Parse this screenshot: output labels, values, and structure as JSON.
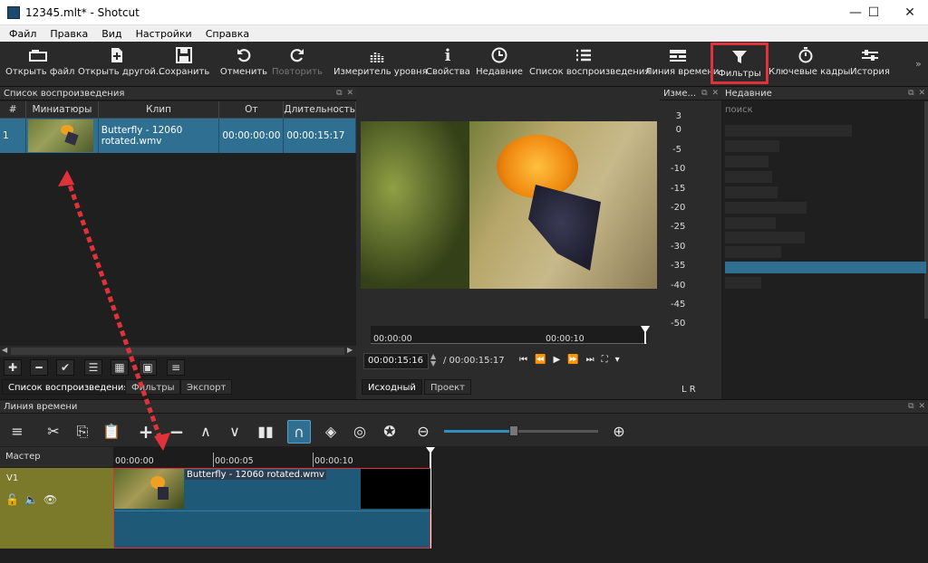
{
  "window": {
    "title": "12345.mlt* - Shotcut",
    "min": "—",
    "max": "☐",
    "close": "✕"
  },
  "menu": [
    "Файл",
    "Правка",
    "Вид",
    "Настройки",
    "Справка"
  ],
  "toolbar": [
    {
      "label": "Открыть файл",
      "icon": "open-file-icon"
    },
    {
      "label": "Открыть другой...",
      "icon": "open-other-icon"
    },
    {
      "label": "Сохранить",
      "icon": "save-icon"
    },
    {
      "label": "Отменить",
      "icon": "undo-icon"
    },
    {
      "label": "Повторить",
      "icon": "redo-icon"
    },
    {
      "label": "Измеритель уровня",
      "icon": "audio-meter-icon"
    },
    {
      "label": "Свойства",
      "icon": "info-icon"
    },
    {
      "label": "Недавние",
      "icon": "clock-icon"
    },
    {
      "label": "Список воспроизведения",
      "icon": "list-icon"
    },
    {
      "label": "Линия времени",
      "icon": "timeline-icon"
    },
    {
      "label": "Фильтры",
      "icon": "filter-icon"
    },
    {
      "label": "Ключевые кадры",
      "icon": "stopwatch-icon"
    },
    {
      "label": "История",
      "icon": "history-icon"
    }
  ],
  "playlist": {
    "title": "Список воспроизведения",
    "columns": [
      "#",
      "Миниатюры",
      "Клип",
      "От",
      "Длительность"
    ],
    "rows": [
      {
        "num": "1",
        "clip": "Butterfly - 12060 rotated.wmv",
        "from": "00:00:00:00",
        "duration": "00:00:15:17"
      }
    ],
    "tabs": [
      "Список воспроизведения",
      "Фильтры",
      "Экспорт"
    ]
  },
  "meter": {
    "title": "Изме...",
    "ticks": [
      "3",
      "0",
      "-5",
      "-10",
      "-15",
      "-20",
      "-25",
      "-30",
      "-35",
      "-40",
      "-45",
      "-50"
    ],
    "lr": "L R"
  },
  "player": {
    "ruler_start": "00:00:00",
    "ruler_mid": "00:00:10",
    "position": "00:00:15:16",
    "duration": "/ 00:00:15:17",
    "tabs": [
      "Исходный",
      "Проект"
    ]
  },
  "recent": {
    "title": "Недавние",
    "search_placeholder": "поиск"
  },
  "timeline": {
    "title": "Линия времени",
    "master": "Мастер",
    "track": "V1",
    "ruler": [
      "00:00:00",
      "00:00:05",
      "00:00:10"
    ],
    "clip": "Butterfly - 12060 rotated.wmv",
    "zoom_fraction": 0.45
  },
  "colors": {
    "accent": "#2e6f92",
    "highlight": "#e0323a",
    "track": "#7a7a2a"
  }
}
